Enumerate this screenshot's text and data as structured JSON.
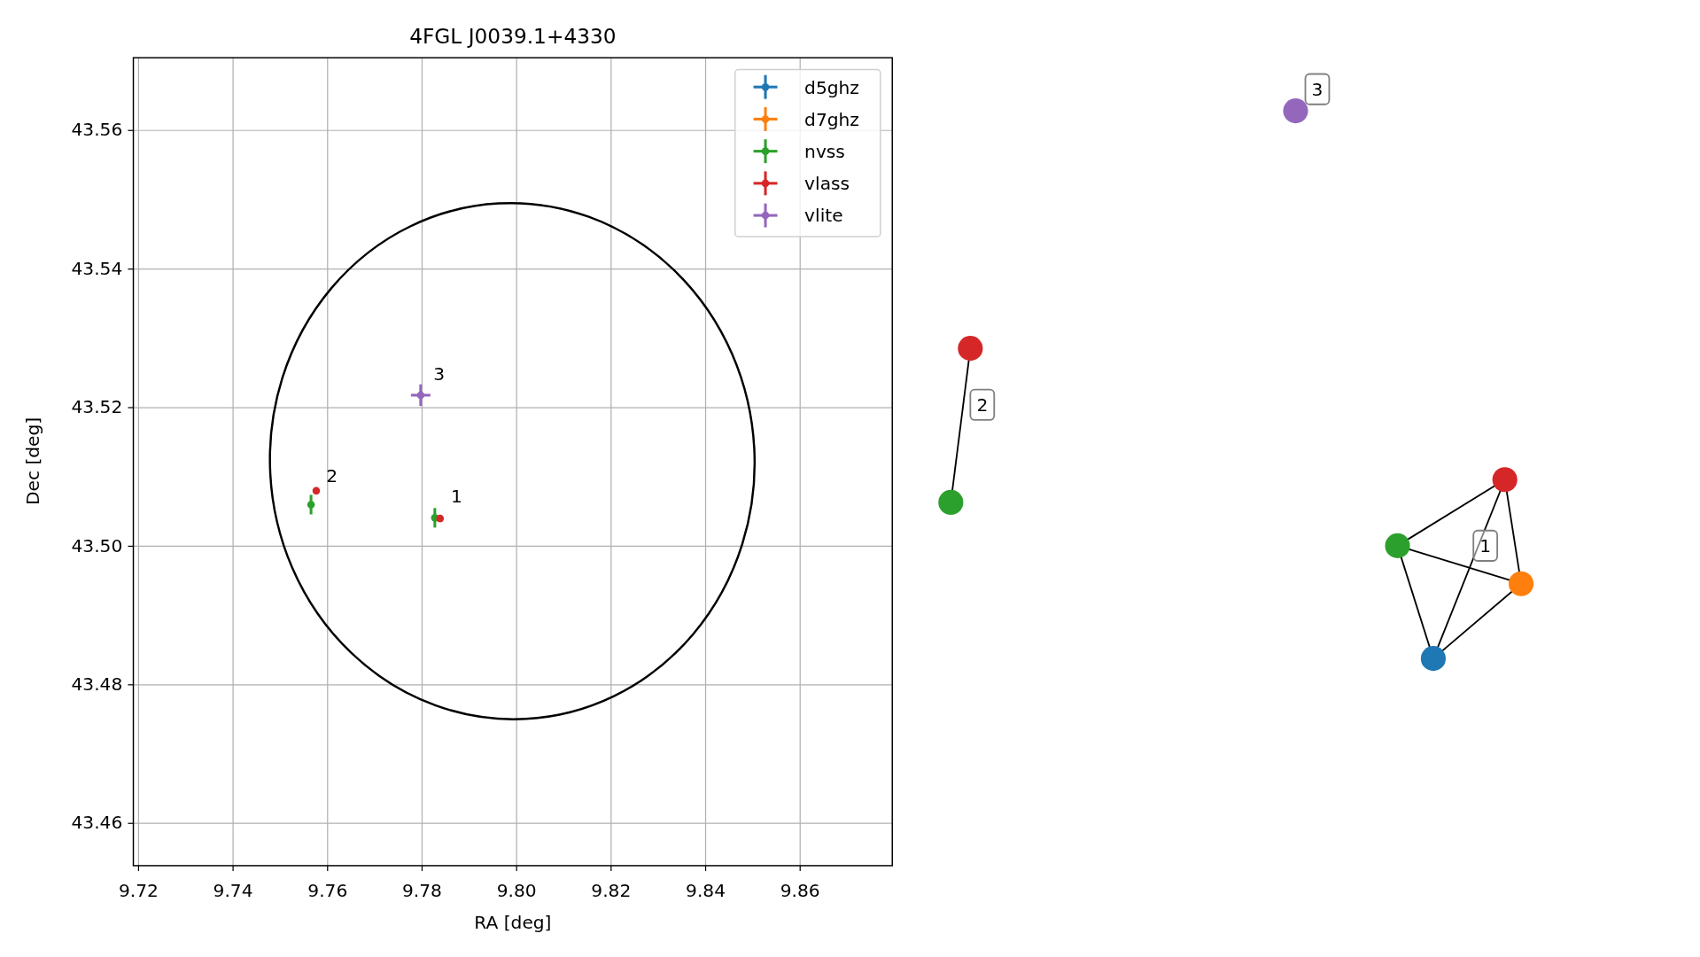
{
  "chart": {
    "chart_data": {
      "type": "scatter",
      "title": "4FGL J0039.1+4330",
      "xlabel": "RA [deg]",
      "ylabel": "Dec [deg]",
      "xlim": [
        9.7189,
        9.8795
      ],
      "ylim": [
        43.4539,
        43.5705
      ],
      "grid": true,
      "legend": "upper right",
      "xticks": [
        {
          "value": 9.72,
          "label": "9.72"
        },
        {
          "value": 9.74,
          "label": "9.74"
        },
        {
          "value": 9.76,
          "label": "9.76"
        },
        {
          "value": 9.78,
          "label": "9.78"
        },
        {
          "value": 9.8,
          "label": "9.80"
        },
        {
          "value": 9.82,
          "label": "9.82"
        },
        {
          "value": 9.84,
          "label": "9.84"
        },
        {
          "value": 9.86,
          "label": "9.86"
        }
      ],
      "yticks": [
        {
          "value": 43.46,
          "label": "43.46"
        },
        {
          "value": 43.48,
          "label": "43.48"
        },
        {
          "value": 43.5,
          "label": "43.50"
        },
        {
          "value": 43.52,
          "label": "43.52"
        },
        {
          "value": 43.54,
          "label": "43.54"
        },
        {
          "value": 43.56,
          "label": "43.56"
        }
      ],
      "series": [
        {
          "name": "d5ghz",
          "color": "#1f77b4"
        },
        {
          "name": "d7ghz",
          "color": "#ff7f0e"
        },
        {
          "name": "nvss",
          "color": "#2ca02c",
          "x": [
            9.7565,
            9.7827
          ],
          "values": [
            43.506,
            43.5041
          ]
        },
        {
          "name": "vlass",
          "color": "#d62728",
          "x": [
            9.7576,
            9.7838
          ],
          "values": [
            43.508,
            43.504
          ]
        },
        {
          "name": "vlite",
          "color": "#9467bd",
          "x": [
            9.7797
          ],
          "values": [
            43.5218
          ]
        }
      ],
      "annotations": [
        "1",
        "2",
        "3"
      ]
    }
  },
  "graph": {
    "groups": [
      {
        "label": "1",
        "nodes": [
          {
            "color": "#1f77b4"
          },
          {
            "color": "#ff7f0e"
          },
          {
            "color": "#2ca02c"
          },
          {
            "color": "#d62728"
          }
        ]
      },
      {
        "label": "2",
        "nodes": [
          {
            "color": "#2ca02c"
          },
          {
            "color": "#d62728"
          }
        ]
      },
      {
        "label": "3",
        "nodes": [
          {
            "color": "#9467bd"
          }
        ]
      }
    ]
  }
}
